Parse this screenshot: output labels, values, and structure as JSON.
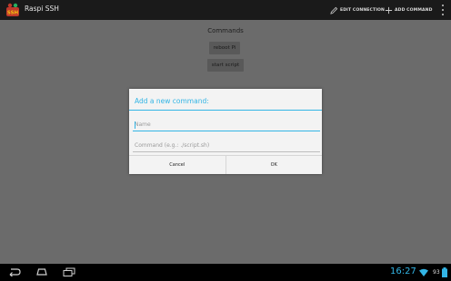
{
  "actionbar": {
    "app_title": "Raspi SSH",
    "app_icon_text": "SSH",
    "edit_connection": "EDIT CONNECTION",
    "add_command": "ADD COMMAND"
  },
  "main": {
    "commands_title": "Commands",
    "commands": [
      "reboot Pi",
      "start script"
    ]
  },
  "dialog": {
    "title": "Add a new command:",
    "name_placeholder": "Name",
    "name_value": "",
    "command_placeholder": "Command (e.g.: ./script.sh)",
    "command_value": "",
    "cancel_label": "Cancel",
    "ok_label": "OK"
  },
  "statusbar": {
    "time": "16:27",
    "battery": "93"
  },
  "colors": {
    "accent": "#33b5e5",
    "dim_background": "#6b6b6b",
    "actionbar": "#1a1a1a"
  }
}
